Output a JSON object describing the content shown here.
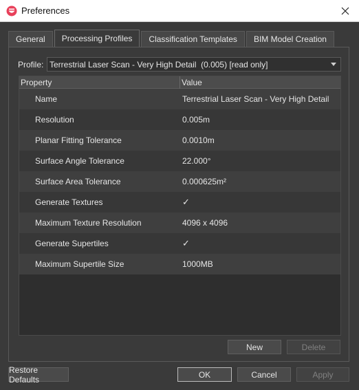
{
  "window": {
    "title": "Preferences"
  },
  "tabs": [
    {
      "label": "General"
    },
    {
      "label": "Processing Profiles"
    },
    {
      "label": "Classification Templates"
    },
    {
      "label": "BIM Model Creation"
    }
  ],
  "profile": {
    "label": "Profile:",
    "selected": "Terrestrial Laser Scan - Very High Detail  (0.005) [read only]"
  },
  "table": {
    "headers": {
      "property": "Property",
      "value": "Value"
    },
    "rows": [
      {
        "property": "Name",
        "value": "Terrestrial Laser Scan - Very High Detail"
      },
      {
        "property": "Resolution",
        "value": "0.005m"
      },
      {
        "property": "Planar Fitting Tolerance",
        "value": "0.0010m"
      },
      {
        "property": "Surface Angle Tolerance",
        "value": "22.000°"
      },
      {
        "property": "Surface Area Tolerance",
        "value": "0.000625m²"
      },
      {
        "property": "Generate Textures",
        "value": "✓"
      },
      {
        "property": "Maximum Texture Resolution",
        "value": "4096 x 4096"
      },
      {
        "property": "Generate Supertiles",
        "value": "✓"
      },
      {
        "property": "Maximum Supertile Size",
        "value": "1000MB"
      }
    ]
  },
  "buttons": {
    "new": "New",
    "delete": "Delete",
    "restore_defaults": "Restore Defaults",
    "ok": "OK",
    "cancel": "Cancel",
    "apply": "Apply"
  }
}
